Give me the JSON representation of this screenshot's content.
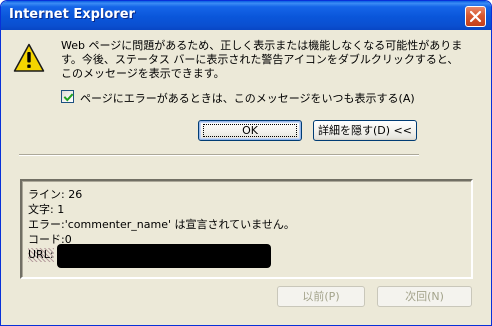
{
  "window": {
    "title": "Internet Explorer"
  },
  "message": {
    "line1": "Web ページに問題があるため、正しく表示または機能しなくなる可能性がありま",
    "line2": "す。今後、ステータス バーに表示された警告アイコンをダブルクリックすると、",
    "line3": "このメッセージを表示できます。"
  },
  "checkbox": {
    "label": "ページにエラーがあるときは、このメッセージをいつも表示する(A)",
    "checked": true
  },
  "buttons": {
    "ok": "OK",
    "hide_details": "詳細を隠す(D) <<",
    "previous": "以前(P)",
    "next": "次回(N)"
  },
  "details": {
    "line_label": "ライン: 26",
    "char_label": "文字: 1",
    "error_label": "エラー:'commenter_name' は宣言されていません。",
    "code_label": "コード:0",
    "url_label": "URL:"
  },
  "icons": {
    "warning": "warning-icon",
    "close": "close-icon",
    "check": "checkmark-icon"
  },
  "colors": {
    "titlebar": "#0a56da",
    "dialog_bg": "#ece9d8",
    "close_button": "#d8582f",
    "warning_yellow": "#f5d400",
    "checkmark": "#21a121"
  }
}
